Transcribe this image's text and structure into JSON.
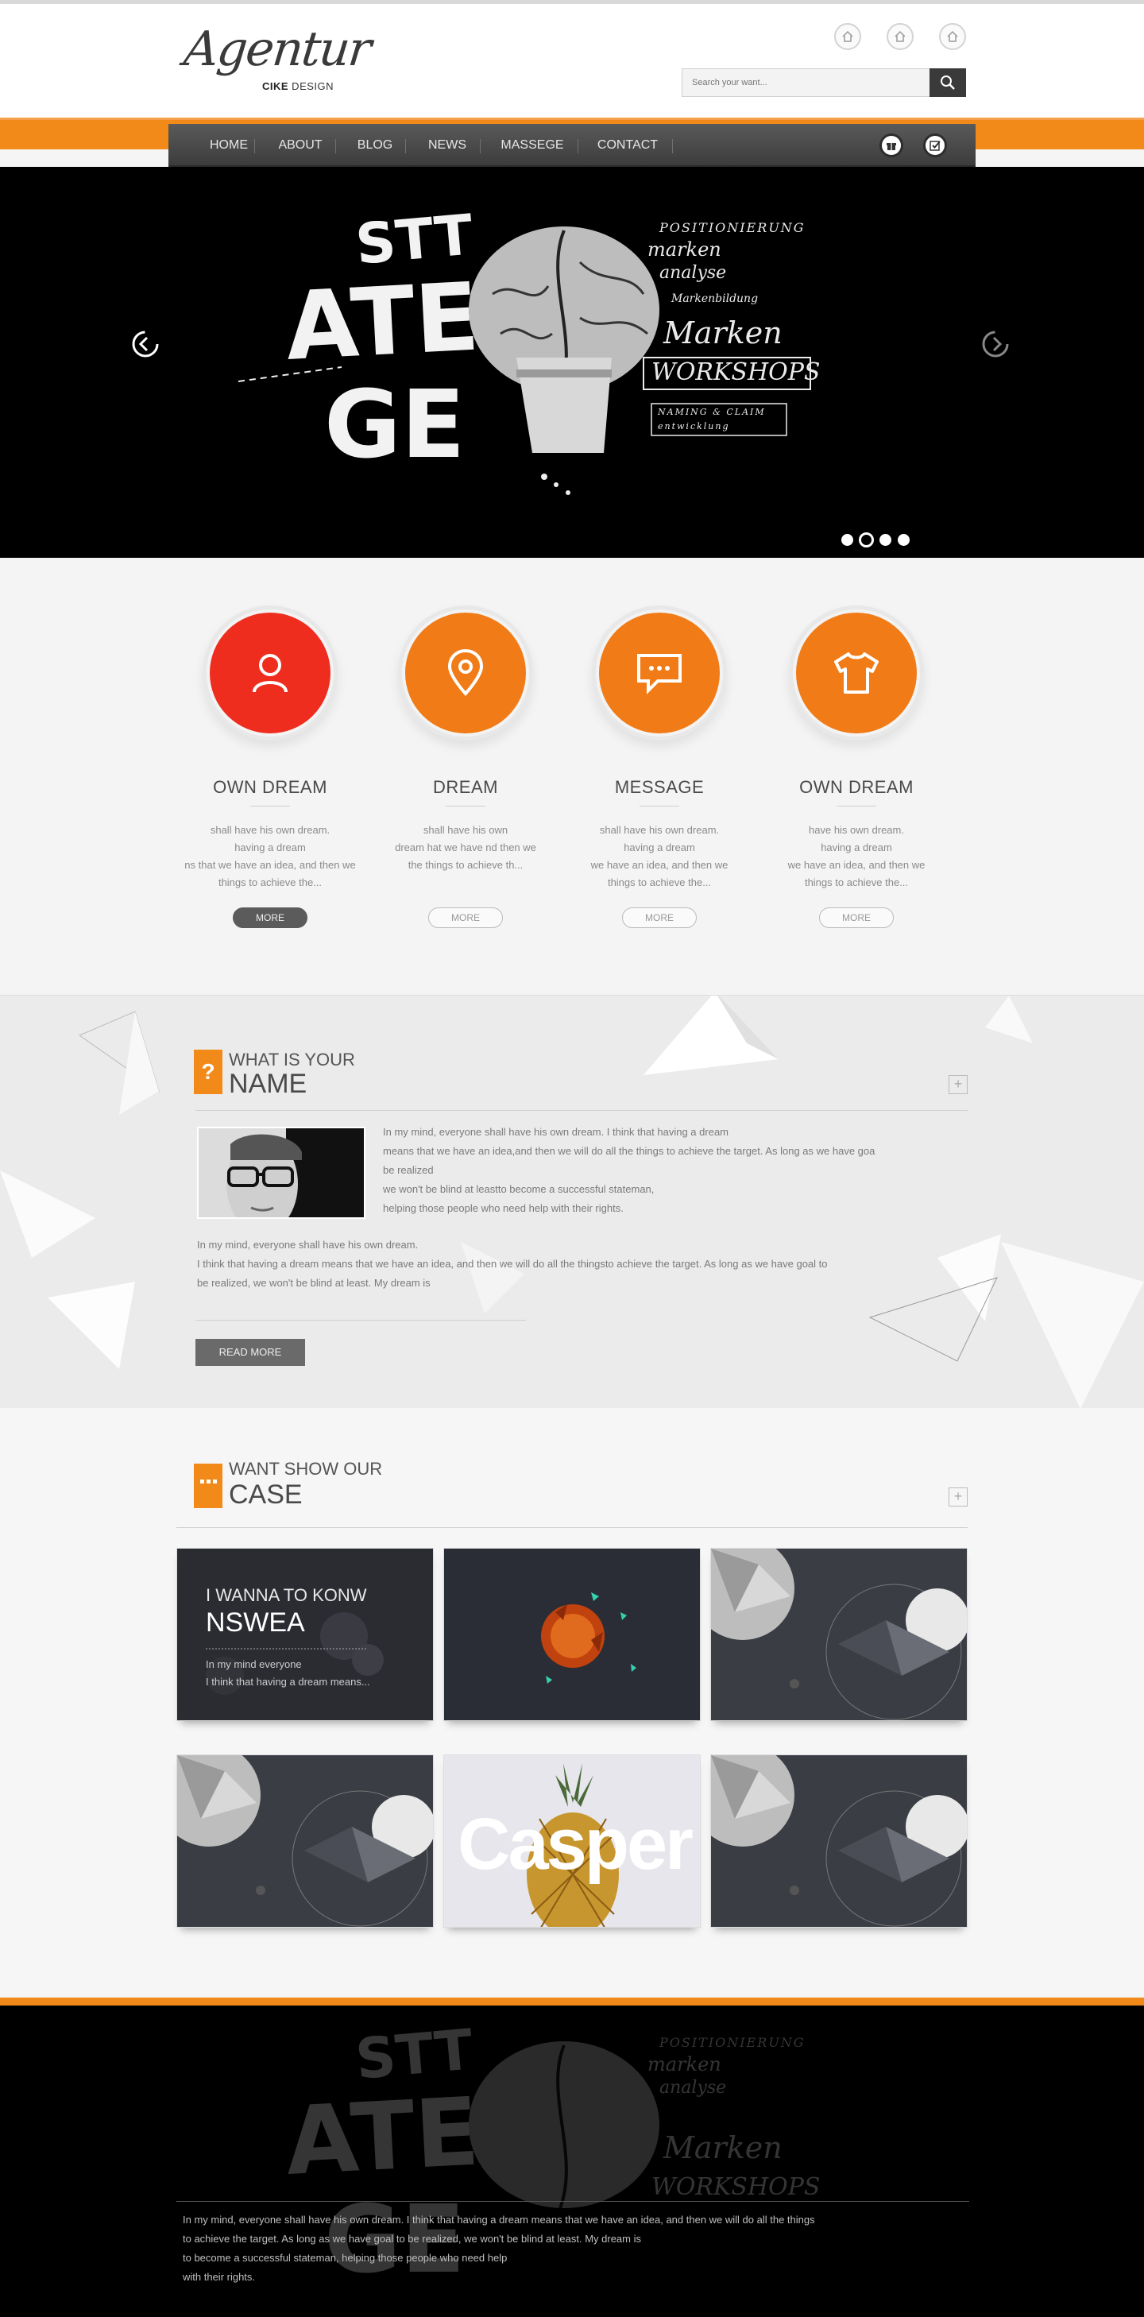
{
  "brand": {
    "script": "Agentur",
    "sub_bold": "CIKE",
    "sub_rest": " DESIGN"
  },
  "header_icons": [
    "home-icon",
    "home-icon",
    "home-icon"
  ],
  "search": {
    "placeholder": "Search your want..."
  },
  "nav": {
    "items": [
      "HOME",
      "ABOUT",
      "BLOG",
      "NEWS",
      "MASSEGE",
      "CONTACT"
    ],
    "right_icons": [
      "gift-icon",
      "check-icon"
    ]
  },
  "hero": {
    "slide_dots": 4,
    "active_dot": 2,
    "art": {
      "words": [
        "STT",
        "ATE",
        "GE"
      ],
      "notes": [
        "POSITIONIERUNG",
        "marken",
        "analyse",
        "Markenbildung",
        "Marken",
        "WORKSHOPS",
        "NAMING & CLAIM",
        "entwicklung"
      ]
    }
  },
  "services": [
    {
      "title": "OWN DREAM",
      "icon": "user-icon",
      "lines": [
        "shall have his own dream.",
        "having a dream",
        "ns that we have an idea, and then we",
        "things to achieve the..."
      ],
      "more": "MORE",
      "highlight": true
    },
    {
      "title": "DREAM",
      "icon": "location-pin-icon",
      "lines": [
        "shall have his own",
        "dream hat we have nd then we",
        "the things to achieve th..."
      ],
      "more": "MORE",
      "highlight": false
    },
    {
      "title": "MESSAGE",
      "icon": "chat-icon",
      "lines": [
        "shall have his own dream.",
        "having a dream",
        "we have an idea, and then we",
        "things to achieve the..."
      ],
      "more": "MORE",
      "highlight": false
    },
    {
      "title": "OWN DREAM",
      "icon": "tshirt-icon",
      "lines": [
        "have his own dream.",
        "having a dream",
        "we have an idea, and then we",
        "things to achieve the..."
      ],
      "more": "MORE",
      "highlight": false
    }
  ],
  "about": {
    "icon_glyph": "?",
    "small_title": "WHAT IS YOUR",
    "big_title": "NAME",
    "plus": "+",
    "side_lines": [
      "In my mind, everyone shall have his own dream. I think that having a dream",
      "means that we have an idea,and then we will do all the things to achieve the target. As long as we have goa",
      "be realized",
      "we won't be blind at leastto become a successful stateman,",
      "helping those people who need help with their rights."
    ],
    "body_lines": [
      "In my mind, everyone shall have his own dream.",
      "I think that having a dream means that we have an idea, and then we will do all the thingsto achieve the target. As long as we have goal to",
      "be realized, we won't be blind at least. My dream is"
    ],
    "read_more": "READ MORE"
  },
  "cases": {
    "small_title": "WANT SHOW OUR",
    "big_title": "CASE",
    "plus": "+",
    "feature": {
      "line1": "I WANNA TO KONW",
      "line2": "NSWEA",
      "text1": "In my mind everyone",
      "text2": "I think that having a dream means..."
    },
    "casper_word": "Casper"
  },
  "footer": {
    "lines": [
      "In my mind, everyone shall have his own dream. I think that having a dream means that we have an idea, and then we will do all the things",
      "to achieve the target. As long as we have goal to be realized, we won't be blind at least. My dream is",
      "to become a successful stateman, helping those people who need help",
      "with their rights."
    ]
  },
  "colors": {
    "accent": "#f28a1a",
    "highlight": "#ef2d1e",
    "dark": "#3a3a3a"
  }
}
